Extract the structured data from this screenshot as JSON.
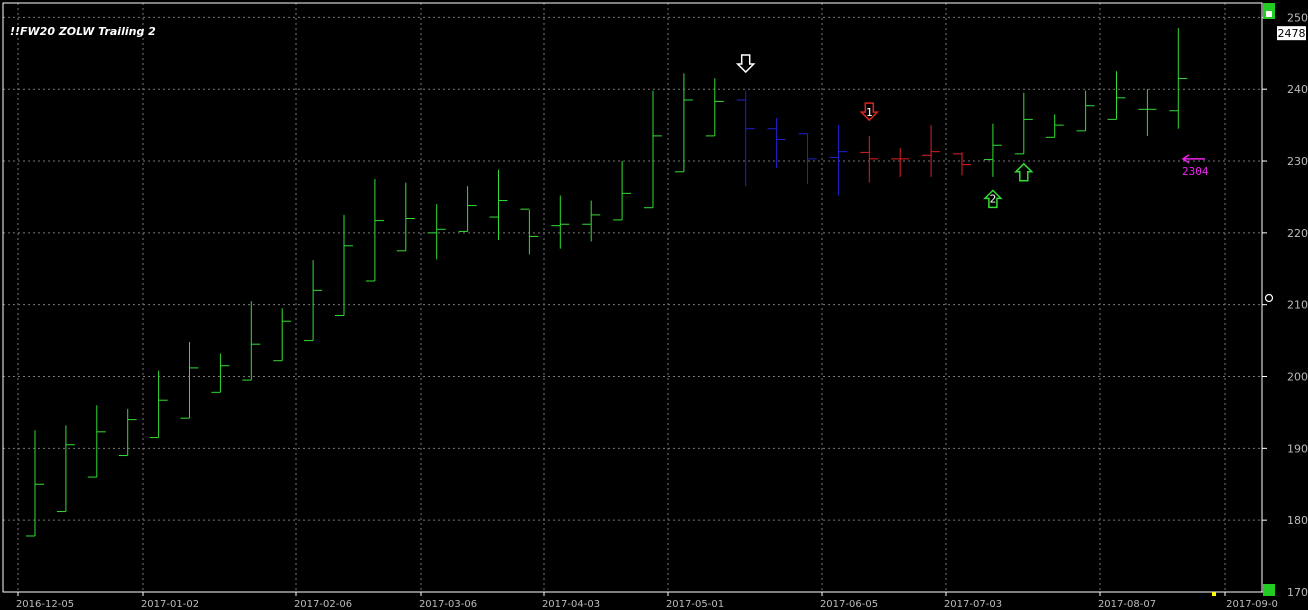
{
  "chart_data": {
    "type": "ohlc",
    "title": "!!FW20 ZOLW Trailing 2",
    "ylim": [
      1700,
      2520
    ],
    "yticks": [
      1700,
      1800,
      1900,
      2000,
      2100,
      2200,
      2300,
      2400,
      2500
    ],
    "grid": true,
    "x_tick_labels": [
      "2016-12-05",
      "2017-01-02",
      "2017-02-06",
      "2017-03-06",
      "2017-04-03",
      "2017-05-01",
      "2017-06-05",
      "2017-07-03",
      "2017-08-07",
      "2017-09-0"
    ],
    "last_price_label": "2478",
    "target_label": "2304",
    "colors": {
      "up": "#33dd33",
      "down": "#2222cc",
      "short": "#dd2222",
      "white": "#ffffff",
      "magenta": "#ee22ee",
      "grid": "#777777",
      "axis": "#ffffff"
    },
    "bars": [
      {
        "o": 1778,
        "h": 1925,
        "l": 1778,
        "c": 1850,
        "col": "up"
      },
      {
        "o": 1812,
        "h": 1932,
        "l": 1812,
        "c": 1905,
        "col": "up"
      },
      {
        "o": 1860,
        "h": 1960,
        "l": 1860,
        "c": 1923,
        "col": "up"
      },
      {
        "o": 1890,
        "h": 1955,
        "l": 1890,
        "c": 1940,
        "col": "up"
      },
      {
        "o": 1915,
        "h": 2008,
        "l": 1915,
        "c": 1967,
        "col": "up"
      },
      {
        "o": 1942,
        "h": 2048,
        "l": 1942,
        "c": 2012,
        "col": "up"
      },
      {
        "o": 1978,
        "h": 2032,
        "l": 1978,
        "c": 2015,
        "col": "up"
      },
      {
        "o": 1995,
        "h": 2105,
        "l": 1995,
        "c": 2045,
        "col": "up"
      },
      {
        "o": 2022,
        "h": 2095,
        "l": 2022,
        "c": 2077,
        "col": "up"
      },
      {
        "o": 2050,
        "h": 2162,
        "l": 2050,
        "c": 2120,
        "col": "up"
      },
      {
        "o": 2085,
        "h": 2225,
        "l": 2085,
        "c": 2182,
        "col": "up"
      },
      {
        "o": 2133,
        "h": 2275,
        "l": 2133,
        "c": 2217,
        "col": "up"
      },
      {
        "o": 2175,
        "h": 2270,
        "l": 2175,
        "c": 2220,
        "col": "up"
      },
      {
        "o": 2200,
        "h": 2240,
        "l": 2163,
        "c": 2205,
        "col": "up"
      },
      {
        "o": 2202,
        "h": 2265,
        "l": 2202,
        "c": 2238,
        "col": "up"
      },
      {
        "o": 2222,
        "h": 2288,
        "l": 2190,
        "c": 2245,
        "col": "up"
      },
      {
        "o": 2233,
        "h": 2232,
        "l": 2170,
        "c": 2195,
        "col": "up"
      },
      {
        "o": 2210,
        "h": 2252,
        "l": 2178,
        "c": 2212,
        "col": "up"
      },
      {
        "o": 2212,
        "h": 2245,
        "l": 2188,
        "c": 2225,
        "col": "up"
      },
      {
        "o": 2218,
        "h": 2300,
        "l": 2218,
        "c": 2255,
        "col": "up"
      },
      {
        "o": 2235,
        "h": 2398,
        "l": 2235,
        "c": 2335,
        "col": "up"
      },
      {
        "o": 2285,
        "h": 2422,
        "l": 2285,
        "c": 2385,
        "col": "up"
      },
      {
        "o": 2335,
        "h": 2415,
        "l": 2335,
        "c": 2383,
        "col": "up"
      },
      {
        "o": 2385,
        "h": 2398,
        "l": 2265,
        "c": 2345,
        "col": "down"
      },
      {
        "o": 2345,
        "h": 2360,
        "l": 2290,
        "c": 2330,
        "col": "down"
      },
      {
        "o": 2338,
        "h": 2338,
        "l": 2268,
        "c": 2303,
        "col": "down"
      },
      {
        "o": 2305,
        "h": 2350,
        "l": 2252,
        "c": 2313,
        "col": "down"
      },
      {
        "o": 2312,
        "h": 2335,
        "l": 2270,
        "c": 2303,
        "col": "short"
      },
      {
        "o": 2303,
        "h": 2318,
        "l": 2278,
        "c": 2303,
        "col": "short"
      },
      {
        "o": 2308,
        "h": 2350,
        "l": 2278,
        "c": 2313,
        "col": "short"
      },
      {
        "o": 2310,
        "h": 2312,
        "l": 2280,
        "c": 2295,
        "col": "short"
      },
      {
        "o": 2302,
        "h": 2352,
        "l": 2278,
        "c": 2322,
        "col": "up"
      },
      {
        "o": 2310,
        "h": 2395,
        "l": 2310,
        "c": 2358,
        "col": "up"
      },
      {
        "o": 2333,
        "h": 2365,
        "l": 2333,
        "c": 2350,
        "col": "up"
      },
      {
        "o": 2342,
        "h": 2398,
        "l": 2342,
        "c": 2377,
        "col": "up"
      },
      {
        "o": 2358,
        "h": 2425,
        "l": 2358,
        "c": 2388,
        "col": "up"
      },
      {
        "o": 2372,
        "h": 2400,
        "l": 2335,
        "c": 2372,
        "col": "up"
      },
      {
        "o": 2370,
        "h": 2485,
        "l": 2345,
        "c": 2415,
        "col": "up"
      }
    ],
    "annotations": [
      {
        "type": "arrow-down",
        "color": "white",
        "bar": 23,
        "value": 2435,
        "label": ""
      },
      {
        "type": "arrow-down",
        "color": "short",
        "bar": 27,
        "value": 2368,
        "label": "1"
      },
      {
        "type": "arrow-up",
        "color": "up",
        "bar": 31,
        "value": 2248,
        "label": "2"
      },
      {
        "type": "arrow-up",
        "color": "up",
        "bar": 32,
        "value": 2285,
        "label": ""
      }
    ]
  }
}
